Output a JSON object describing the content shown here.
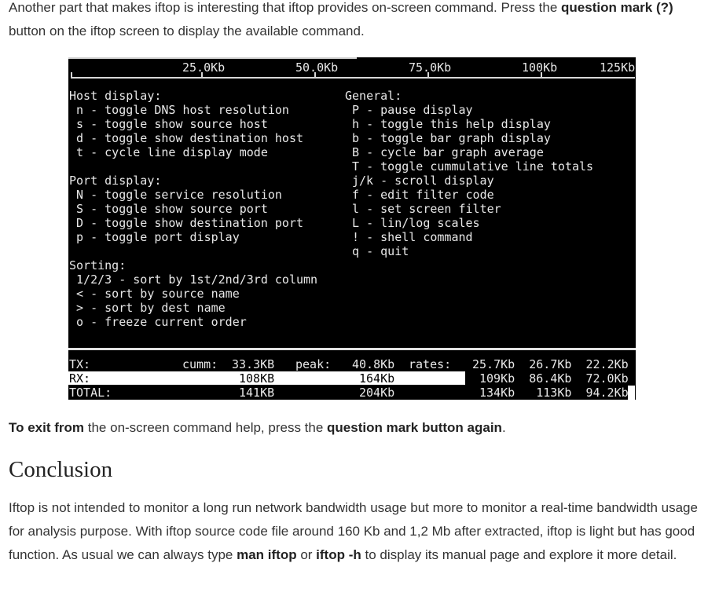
{
  "intro": {
    "text1": "Another part that makes iftop is interesting that iftop provides on-screen command. Press the ",
    "bold1": "question mark (?)",
    "text2": " button on the iftop screen to display the available command."
  },
  "terminal": {
    "scale": [
      "25.0Kb",
      "50.0Kb",
      "75.0Kb",
      "100Kb",
      "125Kb"
    ],
    "host_title": "Host display:",
    "host_items": [
      " n - toggle DNS host resolution",
      " s - toggle show source host",
      " d - toggle show destination host",
      " t - cycle line display mode"
    ],
    "port_title": "Port display:",
    "port_items": [
      " N - toggle service resolution",
      " S - toggle show source port",
      " D - toggle show destination port",
      " p - toggle port display"
    ],
    "sort_title": "Sorting:",
    "sort_items": [
      " 1/2/3 - sort by 1st/2nd/3rd column",
      " < - sort by source name",
      " > - sort by dest name",
      " o - freeze current order"
    ],
    "general_title": "General:",
    "general_items": [
      " P - pause display",
      " h - toggle this help display",
      " b - toggle bar graph display",
      " B - cycle bar graph average",
      " T - toggle cummulative line totals",
      "j/k - scroll display",
      " f - edit filter code",
      " l - set screen filter",
      " L - lin/log scales",
      " ! - shell command",
      " q - quit"
    ],
    "stats": {
      "tx_label": "TX:",
      "rx_label": "RX:",
      "total_label": "TOTAL:",
      "cum_label": "cumm:",
      "peak_label": "peak:",
      "rates_label": "rates:",
      "tx_cum": "33.3KB",
      "rx_cum": "108KB",
      "total_cum": "141KB",
      "tx_peak": "40.8Kb",
      "rx_peak": "164Kb",
      "total_peak": "204Kb",
      "tx_rates": "25.7Kb  26.7Kb  22.2Kb",
      "rx_rates": "109Kb  86.4Kb  72.0Kb",
      "total_rates": "134Kb   113Kb  94.2Kb"
    }
  },
  "exit_line": {
    "bold1": "To exit from",
    "text1": " the on-screen command help, press the ",
    "bold2": "question mark button again",
    "text2": "."
  },
  "conclusion": {
    "heading": "Conclusion",
    "text1": "Iftop is not intended to monitor a long run network bandwidth usage but more to monitor a real-time bandwidth usage for analysis purpose. With iftop source code file around 160 Kb and 1,2 Mb after extracted, iftop is light but has good function. As usual we can always type ",
    "bold1": "man iftop",
    "text2": " or ",
    "bold2": "iftop -h",
    "text3": " to display its manual page and explore it more detail."
  }
}
